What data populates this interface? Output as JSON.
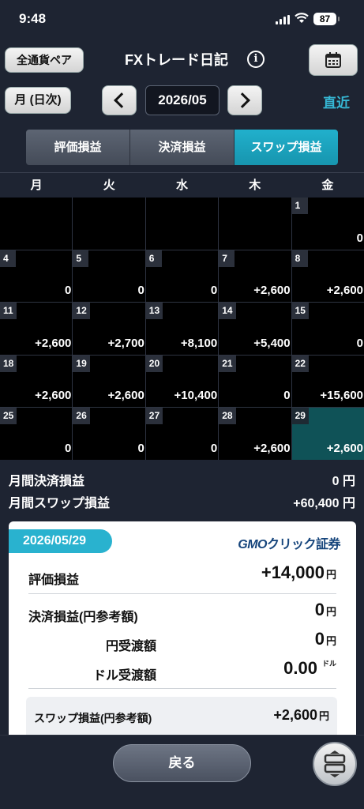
{
  "status": {
    "time": "9:48",
    "battery": "87"
  },
  "header": {
    "all_pairs_label": "全通貨ペア",
    "title": "FXトレード日記",
    "info_icon": "i"
  },
  "nav": {
    "mode_label": "月 (日次)",
    "month": "2026/05",
    "recent_label": "直近"
  },
  "tabs": [
    {
      "label": "評価損益",
      "active": false
    },
    {
      "label": "決済損益",
      "active": false
    },
    {
      "label": "スワップ損益",
      "active": true
    }
  ],
  "weekdays": [
    "月",
    "火",
    "水",
    "木",
    "金"
  ],
  "calendar": [
    {
      "day": "",
      "value": ""
    },
    {
      "day": "",
      "value": ""
    },
    {
      "day": "",
      "value": ""
    },
    {
      "day": "",
      "value": ""
    },
    {
      "day": "1",
      "value": "0"
    },
    {
      "day": "4",
      "value": "0"
    },
    {
      "day": "5",
      "value": "0"
    },
    {
      "day": "6",
      "value": "0"
    },
    {
      "day": "7",
      "value": "+2,600"
    },
    {
      "day": "8",
      "value": "+2,600"
    },
    {
      "day": "11",
      "value": "+2,600"
    },
    {
      "day": "12",
      "value": "+2,700"
    },
    {
      "day": "13",
      "value": "+8,100"
    },
    {
      "day": "14",
      "value": "+5,400"
    },
    {
      "day": "15",
      "value": "0"
    },
    {
      "day": "18",
      "value": "+2,600"
    },
    {
      "day": "19",
      "value": "+2,600"
    },
    {
      "day": "20",
      "value": "+10,400"
    },
    {
      "day": "21",
      "value": "0"
    },
    {
      "day": "22",
      "value": "+15,600"
    },
    {
      "day": "25",
      "value": "0"
    },
    {
      "day": "26",
      "value": "0"
    },
    {
      "day": "27",
      "value": "0"
    },
    {
      "day": "28",
      "value": "+2,600"
    },
    {
      "day": "29",
      "value": "+2,600",
      "selected": true
    }
  ],
  "summary": {
    "settled_label": "月間決済損益",
    "settled_value": "0 円",
    "swap_label": "月間スワップ損益",
    "swap_value": "+60,400 円"
  },
  "detail": {
    "date": "2026/05/29",
    "logo_gmo": "GMO",
    "logo_rest": "クリック証券",
    "valuation_label": "評価損益",
    "valuation_value": "+14,000",
    "settled_label": "決済損益(円参考額)",
    "settled_value": "0",
    "yen_transfer_label": "円受渡額",
    "yen_transfer_value": "0",
    "dollar_transfer_label": "ドル受渡額",
    "dollar_transfer_value": "0.00",
    "unit_yen": "円",
    "unit_dollar": "ドル",
    "swap_label": "スワップ損益(円参考額)",
    "swap_value": "+2,600"
  },
  "bottom": {
    "back_label": "戻る"
  },
  "colors": {
    "accent": "#29b2cf",
    "selected_cell": "#0f5257",
    "background": "#1e2432"
  }
}
